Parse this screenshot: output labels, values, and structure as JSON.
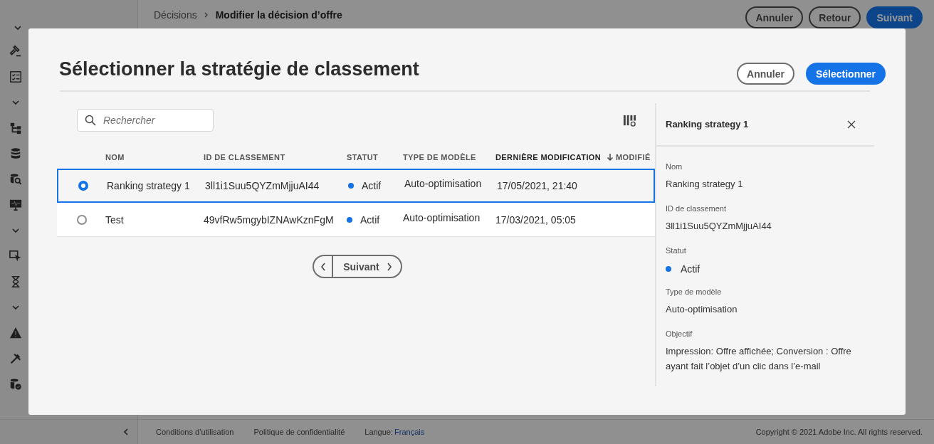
{
  "app": {
    "breadcrumb": [
      {
        "label": "Décisions",
        "current": false
      },
      {
        "label": "Modifier la décision d’offre",
        "current": true
      }
    ],
    "actions": [
      {
        "label": "Annuler",
        "kind": "secondary"
      },
      {
        "label": "Retour",
        "kind": "secondary"
      },
      {
        "label": "Suivant",
        "kind": "primary"
      }
    ],
    "footer": {
      "links": [
        "Conditions d’utilisation",
        "Politique de confidentialité"
      ],
      "language_label": "Langue:",
      "language": "Français",
      "copyright": "Copyright ©  2021 Adobe Inc.  All rights reserved."
    }
  },
  "dialog": {
    "title": "Sélectionner la stratégie de classement",
    "buttons": [
      {
        "label": "Annuler",
        "kind": "secondary"
      },
      {
        "label": "Sélectionner",
        "kind": "primary"
      }
    ],
    "search": {
      "placeholder": "Rechercher"
    },
    "table": {
      "columns": [
        {
          "label": "NOM",
          "sorted": false
        },
        {
          "label": "ID DE CLASSEMENT",
          "sorted": false
        },
        {
          "label": "STATUT",
          "sorted": false
        },
        {
          "label": "TYPE DE MODÈLE",
          "sorted": false
        },
        {
          "label": "DERNIÈRE MODIFICATION",
          "sorted": true
        },
        {
          "label": "MODIFIÉ",
          "sorted": false
        }
      ],
      "rows": [
        {
          "selected": true,
          "name": "Ranking strategy 1",
          "id": "3ll1i1Suu5QYZmMjjuAI44",
          "status": "Actif",
          "color": "#1473e6",
          "model_type": "Auto-optimisation",
          "modified": "17/05/2021, 21:40"
        },
        {
          "selected": false,
          "name": "Test",
          "id": "49vfRw5mgybIZNAwKznFgM",
          "status": "Actif",
          "color": "#1473e6",
          "model_type": "Auto-optimisation",
          "modified": "17/03/2021, 05:05"
        }
      ]
    },
    "pagination": {
      "next_label": "Suivant"
    },
    "details": {
      "title": "Ranking strategy 1",
      "fields": [
        {
          "kind": "text",
          "label": "Nom",
          "value": "Ranking strategy 1"
        },
        {
          "kind": "text",
          "label": "ID de classement",
          "value": "3ll1i1Suu5QYZmMjjuAI44"
        },
        {
          "kind": "status",
          "label": "Statut",
          "value": "Actif",
          "color": "#1473e6"
        },
        {
          "kind": "text",
          "label": "Type de modèle",
          "value": "Auto-optimisation"
        },
        {
          "kind": "text",
          "label": "Objectif",
          "value": "Impression: Offre affichée; Conversion : Offre ayant fait l’objet d’un clic dans l’e-mail"
        }
      ]
    }
  }
}
